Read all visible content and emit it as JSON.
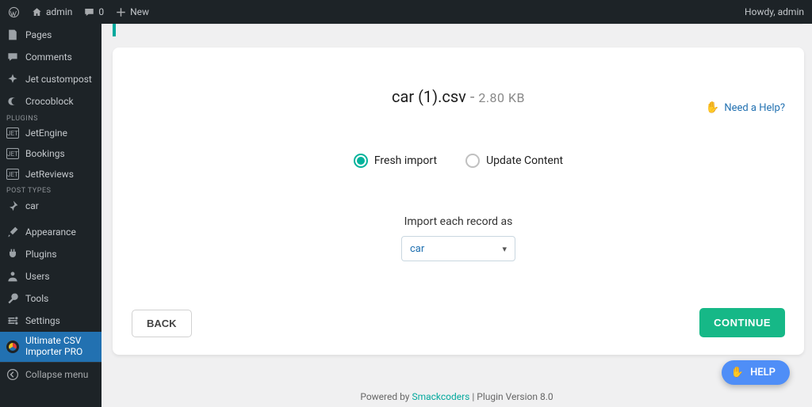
{
  "adminbar": {
    "site_name": "admin",
    "comments_count": "0",
    "new_label": "New",
    "howdy": "Howdy, admin"
  },
  "sidebar": {
    "items": [
      {
        "label": "Pages"
      },
      {
        "label": "Comments"
      },
      {
        "label": "Jet custompost"
      },
      {
        "label": "Crocoblock"
      }
    ],
    "plugins_heading": "PLUGINS",
    "plugins": [
      {
        "label": "JetEngine"
      },
      {
        "label": "Bookings"
      },
      {
        "label": "JetReviews"
      }
    ],
    "post_types_heading": "POST TYPES",
    "post_types": [
      {
        "label": "car"
      }
    ],
    "admin_items": [
      {
        "label": "Appearance"
      },
      {
        "label": "Plugins"
      },
      {
        "label": "Users"
      },
      {
        "label": "Tools"
      },
      {
        "label": "Settings"
      }
    ],
    "current_item": {
      "label_line1": "Ultimate CSV",
      "label_line2": "Importer PRO"
    },
    "collapse_label": "Collapse menu"
  },
  "panel": {
    "file_name": "car (1).csv",
    "file_size": "2.80 KB",
    "need_help": "Need a Help?",
    "radio_fresh": "Fresh import",
    "radio_update": "Update Content",
    "import_label": "Import each record as",
    "select_value": "car",
    "back_label": "BACK",
    "continue_label": "CONTINUE"
  },
  "footer": {
    "prefix": "Powered by ",
    "link_text": "Smackcoders",
    "suffix": " | Plugin Version 8.0"
  },
  "help_fab": "HELP",
  "colors": {
    "teal": "#04b39b",
    "green_btn": "#16b887",
    "wp_blue": "#2271b1",
    "fab_blue": "#4f8ef7"
  }
}
